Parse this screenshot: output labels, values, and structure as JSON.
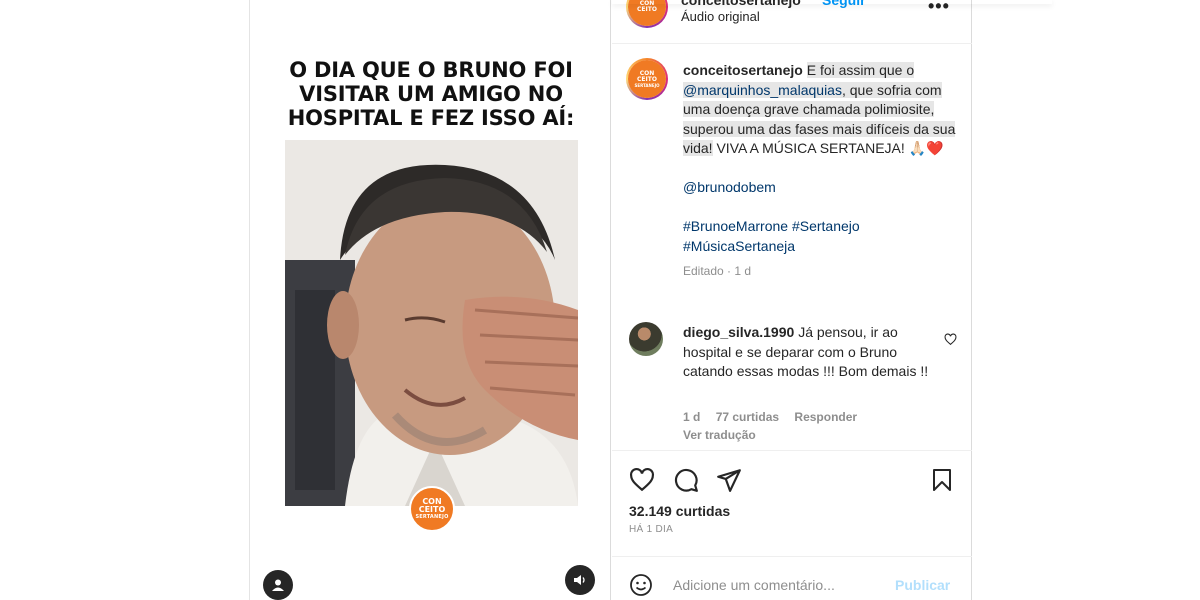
{
  "media": {
    "title_lines": [
      "O DIA QUE O BRUNO FOI",
      "VISITAR UM AMIGO NO",
      "HOSPITAL E FEZ ISSO AÍ:"
    ],
    "brand_logo_line1": "CON\nCEITO",
    "brand_logo_line2": "SERTANEJO"
  },
  "header": {
    "username": "conceitosertanejo",
    "follow_label": "Seguir",
    "audio_label": "Áudio original",
    "more_label": "•••"
  },
  "caption": {
    "username": "conceitosertanejo",
    "text_part1": "E foi assim que o",
    "mention": "@marquinhos_malaquias",
    "text_part2": ", que sofria com uma doença grave chamada polimiosite, superou uma das fases mais difíceis da sua vida!",
    "text_part3": "VIVA A MÚSICA SERTANEJA! 🙏🏻❤️",
    "mention2": "@brunodobem",
    "hashtags_line1": "#BrunoeMarrone #Sertanejo",
    "hashtags_line2": "#MúsicaSertaneja",
    "edited": "Editado · 1 d"
  },
  "comment": {
    "username": "diego_silva.1990",
    "text": "Já pensou, ir ao hospital e se deparar com o Bruno catando essas modas !!! Bom demais !!",
    "age": "1 d",
    "likes": "77 curtidas",
    "reply_label": "Responder",
    "translate_label": "Ver tradução"
  },
  "post": {
    "likes": "32.149 curtidas",
    "time": "HÁ 1 DIA"
  },
  "composer": {
    "placeholder": "Adicione um comentário...",
    "publish_label": "Publicar"
  },
  "icons": [
    "user-icon",
    "sound-icon",
    "heart-icon",
    "comment-icon",
    "share-icon",
    "bookmark-icon",
    "emoji-icon",
    "more-icon"
  ]
}
